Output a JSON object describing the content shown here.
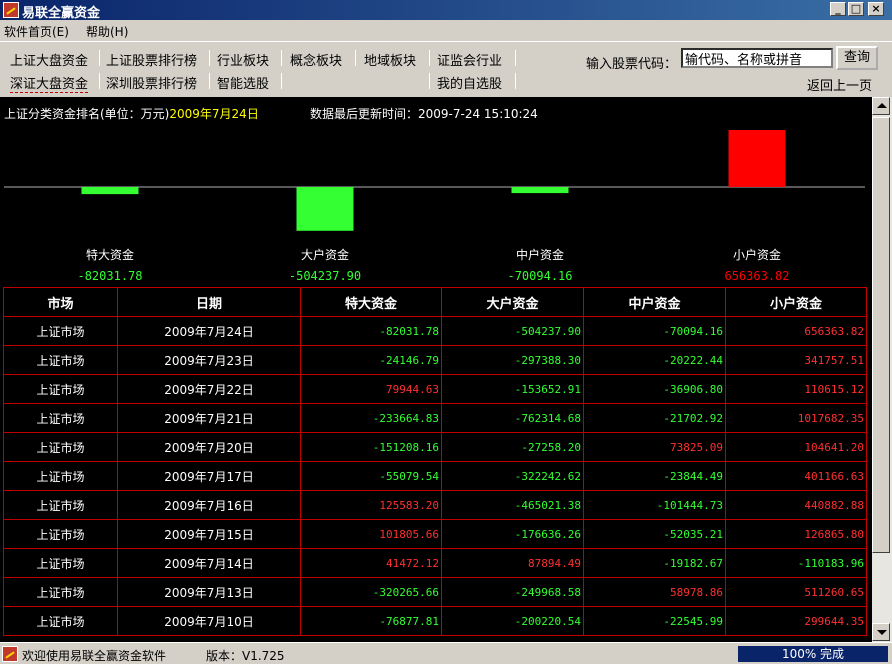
{
  "window": {
    "title": "易联全赢资金"
  },
  "menu": [
    {
      "label": "软件首页(E)"
    },
    {
      "label": "帮助(H)"
    }
  ],
  "nav_row1": [
    "上证大盘资金",
    "上证股票排行榜",
    "行业板块",
    "概念板块",
    "地域板块",
    "证监会行业"
  ],
  "nav_row2": [
    "深证大盘资金",
    "深圳股票排行榜",
    "智能选股",
    "我的自选股"
  ],
  "search": {
    "label": "输入股票代码：",
    "value": "输代码、名称或拼音",
    "button": "查询"
  },
  "back_label": "返回上一页",
  "chart_header": {
    "title": "上证分类资金排名(单位：万元)",
    "date": "2009年7月24日",
    "update": "数据最后更新时间：2009-7-24 15:10:24"
  },
  "chart_data": {
    "type": "bar",
    "categories": [
      "特大资金",
      "大户资金",
      "中户资金",
      "小户资金"
    ],
    "values": [
      -82031.78,
      -504237.9,
      -70094.16,
      656363.82
    ],
    "value_labels": [
      "-82031.78",
      "-504237.90",
      "-70094.16",
      "656363.82"
    ],
    "colors": {
      "positive": "#ff0000",
      "negative": "#33ff33"
    }
  },
  "table": {
    "headers": [
      "市场",
      "日期",
      "特大资金",
      "大户资金",
      "中户资金",
      "小户资金"
    ],
    "rows": [
      [
        "上证市场",
        "2009年7月24日",
        "-82031.78",
        "-504237.90",
        "-70094.16",
        "656363.82"
      ],
      [
        "上证市场",
        "2009年7月23日",
        "-24146.79",
        "-297388.30",
        "-20222.44",
        "341757.51"
      ],
      [
        "上证市场",
        "2009年7月22日",
        "79944.63",
        "-153652.91",
        "-36906.80",
        "110615.12"
      ],
      [
        "上证市场",
        "2009年7月21日",
        "-233664.83",
        "-762314.68",
        "-21702.92",
        "1017682.35"
      ],
      [
        "上证市场",
        "2009年7月20日",
        "-151208.16",
        "-27258.20",
        "73825.09",
        "104641.20"
      ],
      [
        "上证市场",
        "2009年7月17日",
        "-55079.54",
        "-322242.62",
        "-23844.49",
        "401166.63"
      ],
      [
        "上证市场",
        "2009年7月16日",
        "125583.20",
        "-465021.38",
        "-101444.73",
        "440882.88"
      ],
      [
        "上证市场",
        "2009年7月15日",
        "101805.66",
        "-176636.26",
        "-52035.21",
        "126865.80"
      ],
      [
        "上证市场",
        "2009年7月14日",
        "41472.12",
        "87894.49",
        "-19182.67",
        "-110183.96"
      ],
      [
        "上证市场",
        "2009年7月13日",
        "-320265.66",
        "-249968.58",
        "58978.86",
        "511260.65"
      ],
      [
        "上证市场",
        "2009年7月10日",
        "-76877.81",
        "-200220.54",
        "-22545.99",
        "299644.35"
      ]
    ]
  },
  "status": {
    "text": "欢迎使用易联全赢资金软件",
    "version": "版本：V1.725",
    "progress": "100% 完成"
  }
}
